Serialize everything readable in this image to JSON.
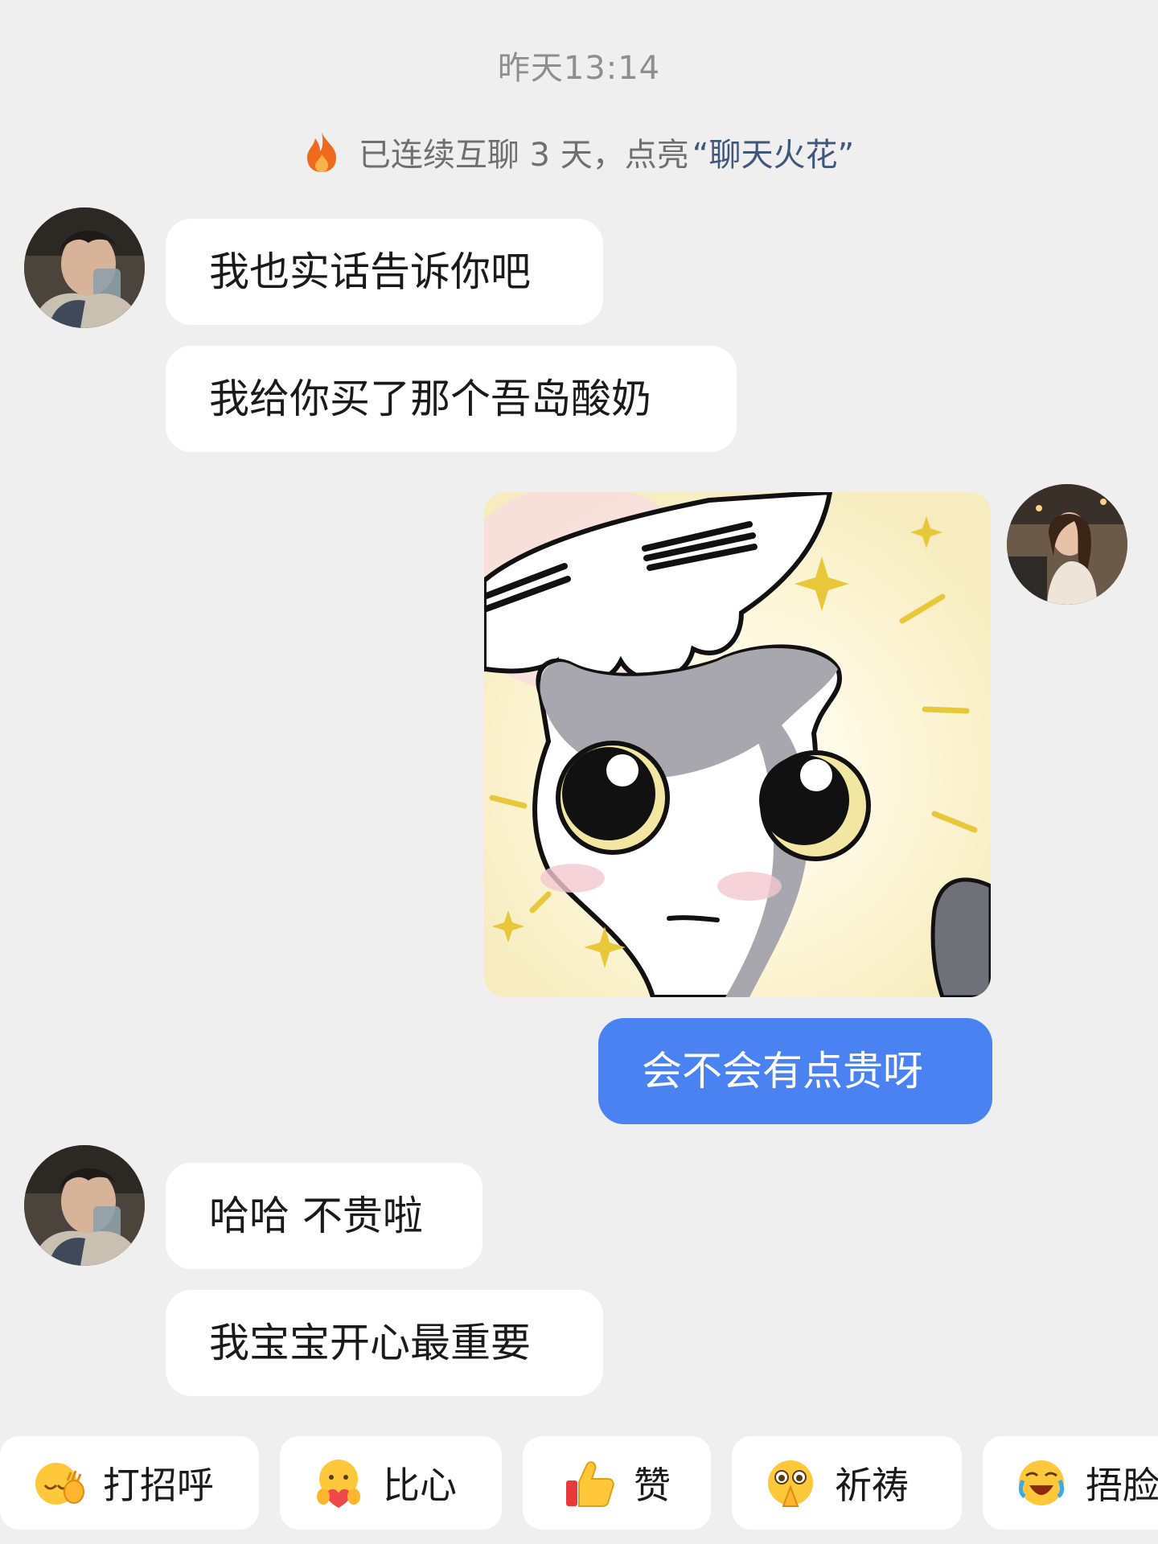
{
  "timestamp": "昨天13:14",
  "streak": {
    "prefix": "已连续互聊 3 天，点亮",
    "highlight": "“聊天火花”",
    "icon": "flame-icon",
    "icon_color": "#f06a1d"
  },
  "messages": [
    {
      "sender": "other",
      "text": "我也实话告诉你吧"
    },
    {
      "sender": "other",
      "text": "我给你买了那个吾岛酸奶"
    },
    {
      "sender": "me",
      "type": "sticker",
      "sticker": "cute-cat-being-patted-sticker"
    },
    {
      "sender": "me",
      "text": "会不会有点贵呀"
    },
    {
      "sender": "other",
      "text": "哈哈 不贵啦"
    },
    {
      "sender": "other",
      "text": "我宝宝开心最重要"
    }
  ],
  "quick_replies": [
    {
      "icon": "wave-hello-emoji-icon",
      "label": "打招呼"
    },
    {
      "icon": "heart-hands-emoji-icon",
      "label": "比心"
    },
    {
      "icon": "thumbs-up-emoji-icon",
      "label": "赞"
    },
    {
      "icon": "pray-emoji-icon",
      "label": "祈祷"
    },
    {
      "icon": "cover-face-laugh-emoji-icon",
      "label": "捂脸"
    }
  ],
  "colors": {
    "background": "#efefef",
    "incoming_bubble": "#ffffff",
    "outgoing_bubble": "#4a83f1",
    "streak_highlight": "#40577a"
  }
}
